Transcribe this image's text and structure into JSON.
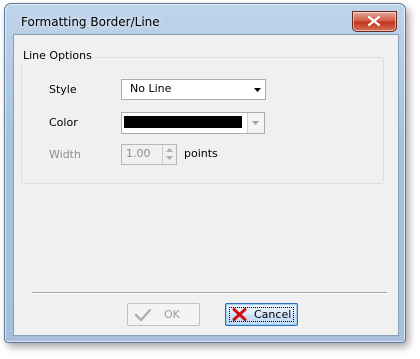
{
  "window": {
    "title": "Formatting Border/Line"
  },
  "group": {
    "title": "Line Options",
    "style_label": "Style",
    "style_value": "No Line",
    "color_label": "Color",
    "color_value": "#000000",
    "width_label": "Width",
    "width_value": "1.00",
    "width_unit": "points"
  },
  "buttons": {
    "ok_label": "OK",
    "cancel_label": "Cancel"
  },
  "icons": {
    "close": "close-icon",
    "dropdown": "chevron-down-icon",
    "ok": "checkmark-icon",
    "cancel": "red-x-icon"
  }
}
